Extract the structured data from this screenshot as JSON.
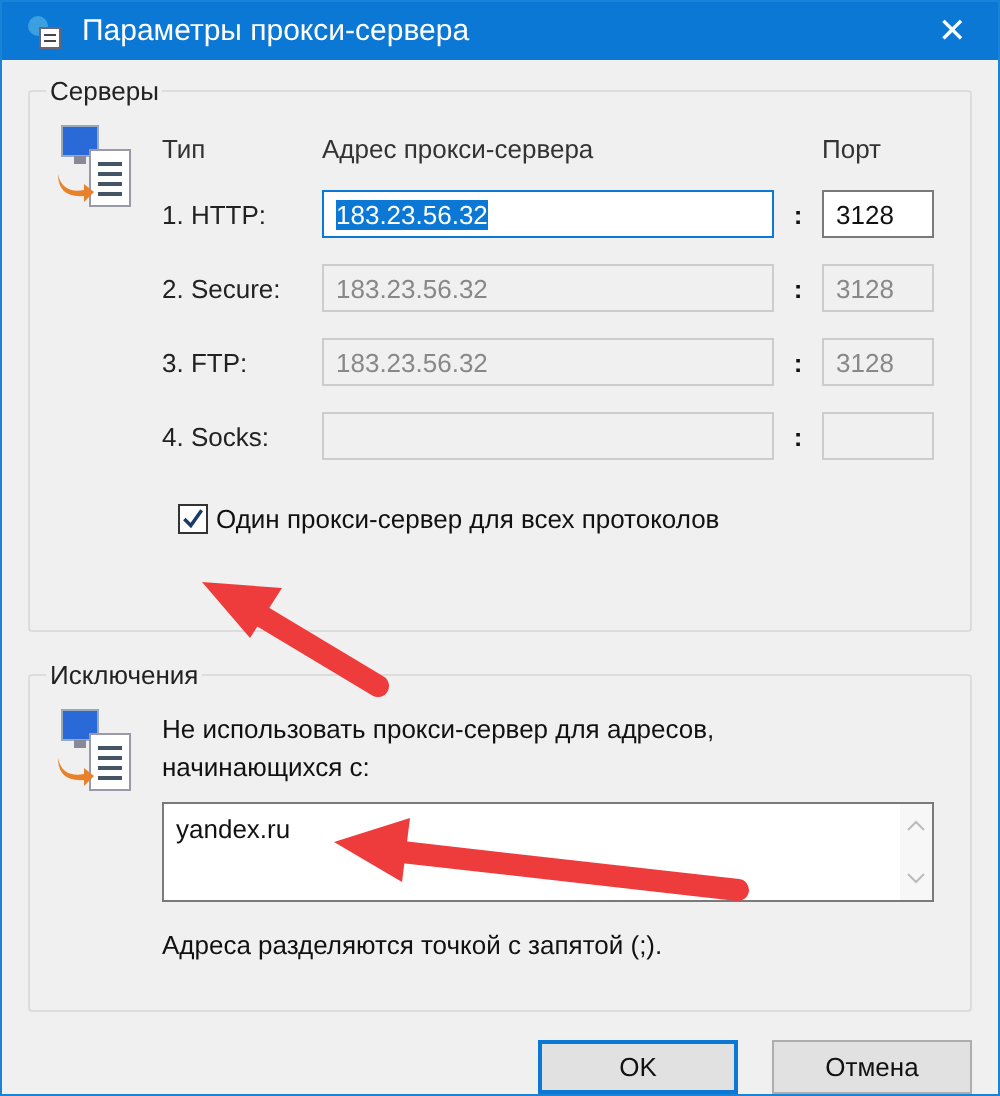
{
  "window": {
    "title": "Параметры прокси-сервера",
    "close": "✕"
  },
  "servers": {
    "title": "Серверы",
    "headers": {
      "type": "Тип",
      "address": "Адрес прокси-сервера",
      "port": "Порт"
    },
    "rows": [
      {
        "label": "1. HTTP:",
        "address": "183.23.56.32",
        "separator": ":",
        "port": "3128",
        "disabled": false,
        "text_selected": true
      },
      {
        "label": "2. Secure:",
        "address": "183.23.56.32",
        "separator": ":",
        "port": "3128",
        "disabled": true,
        "text_selected": false
      },
      {
        "label": "3. FTP:",
        "address": "183.23.56.32",
        "separator": ":",
        "port": "3128",
        "disabled": true,
        "text_selected": false
      },
      {
        "label": "4. Socks:",
        "separator": ":",
        "disabled": true
      }
    ],
    "same_proxy": {
      "label": "Один прокси-сервер для всех протоколов",
      "checked": true
    }
  },
  "exceptions": {
    "title": "Исключения",
    "description": "Не использовать прокси-сервер для адресов, начинающихся с:",
    "value": "yandex.ru",
    "note": "Адреса разделяются точкой с запятой (;)."
  },
  "buttons": [
    {
      "label": "OK",
      "default": true
    },
    {
      "label": "Отмена",
      "default": false
    }
  ]
}
